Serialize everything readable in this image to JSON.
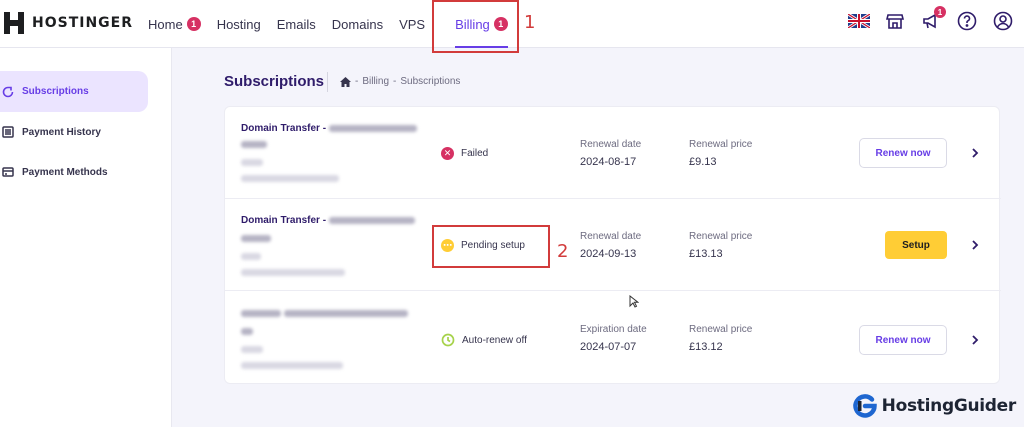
{
  "brand": {
    "name": "HOSTINGER"
  },
  "nav": {
    "items": [
      {
        "label": "Home",
        "badge": "1"
      },
      {
        "label": "Hosting"
      },
      {
        "label": "Emails"
      },
      {
        "label": "Domains"
      },
      {
        "label": "VPS"
      },
      {
        "label": "Billing",
        "badge": "1",
        "active": true
      }
    ],
    "icons": [
      "flag-uk-icon",
      "store-icon",
      "megaphone-icon",
      "help-icon",
      "account-icon"
    ],
    "notification_badge": "1"
  },
  "annotations": {
    "n1": "1",
    "n2": "2"
  },
  "sidebar": {
    "items": [
      {
        "label": "Subscriptions",
        "icon": "subscriptions-icon",
        "active": true
      },
      {
        "label": "Payment History",
        "icon": "history-icon"
      },
      {
        "label": "Payment Methods",
        "icon": "card-icon"
      }
    ]
  },
  "page": {
    "title": "Subscriptions",
    "breadcrumb": [
      "Billing",
      "Subscriptions"
    ],
    "breadcrumb_sep": "-"
  },
  "subscriptions": [
    {
      "name": "Domain Transfer -",
      "status": "Failed",
      "status_color": "#d63163",
      "date_label": "Renewal date",
      "date": "2024-08-17",
      "price_label": "Renewal price",
      "price": "£9.13",
      "action": "Renew now"
    },
    {
      "name": "Domain Transfer -",
      "status": "Pending setup",
      "status_color": "#ffcd35",
      "date_label": "Renewal date",
      "date": "2024-09-13",
      "price_label": "Renewal price",
      "price": "£13.13",
      "action": "Setup"
    },
    {
      "name": "",
      "status": "Auto-renew off",
      "status_color": "#a6d24a",
      "date_label": "Expiration date",
      "date": "2024-07-07",
      "price_label": "Renewal price",
      "price": "£13.12",
      "action": "Renew now"
    }
  ],
  "watermark": {
    "text": "HostingGuider"
  },
  "colors": {
    "accent": "#673de6",
    "danger": "#d63163",
    "warning": "#ffcd35",
    "annotation": "#d23b3b"
  }
}
